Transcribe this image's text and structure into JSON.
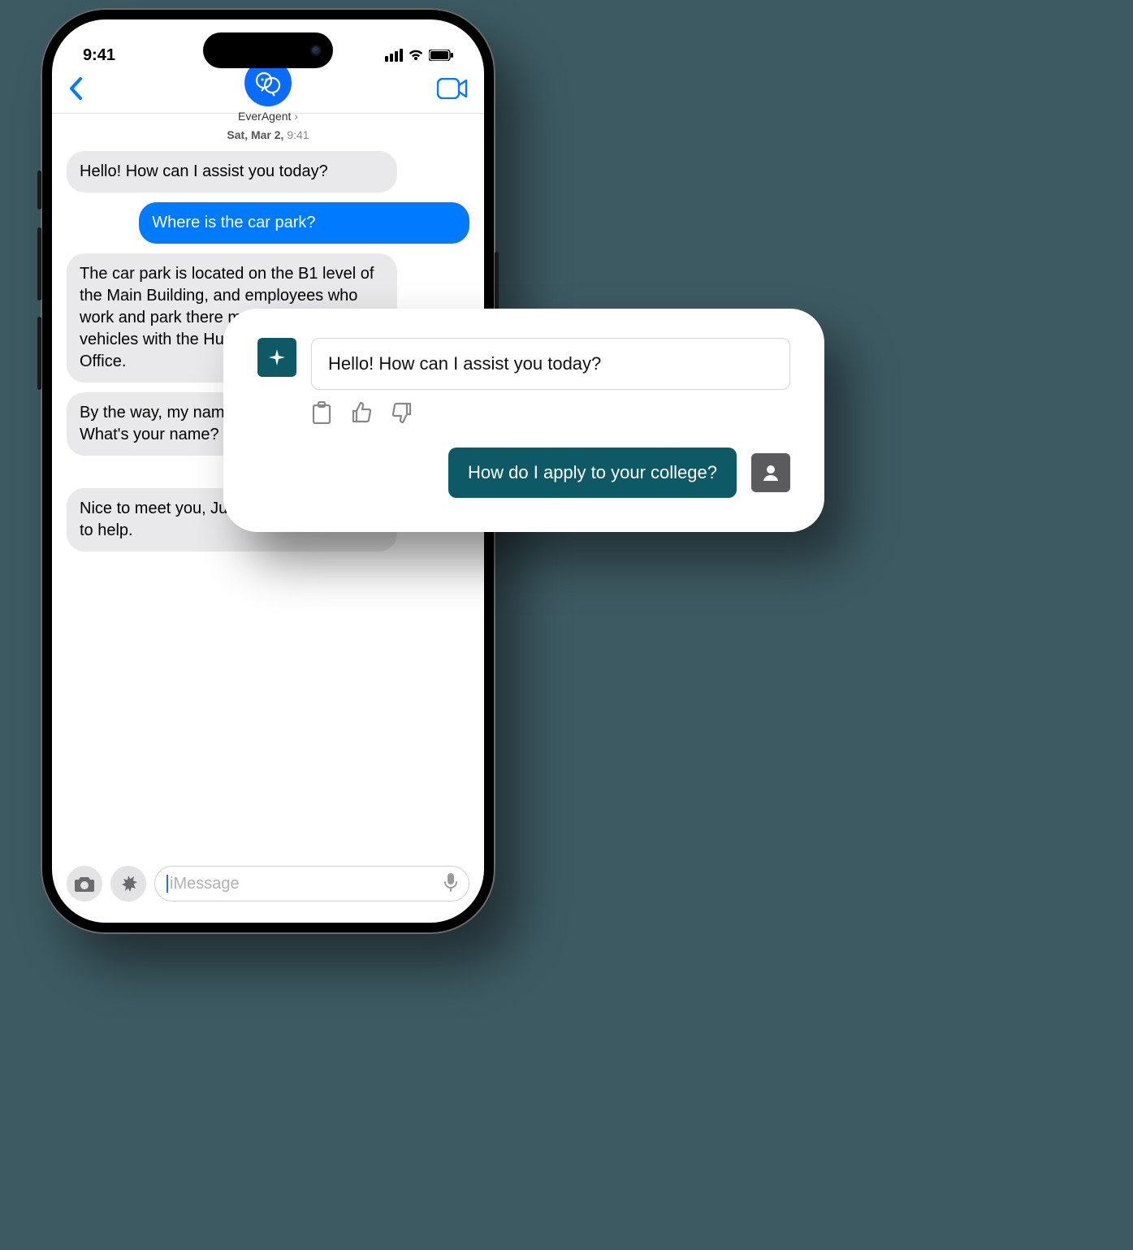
{
  "phone": {
    "status": {
      "time": "9:41"
    },
    "contact_name": "EverAgent",
    "timestamp_prefix": "Sat, Mar 2,",
    "timestamp_time": "9:41",
    "messages": {
      "m1": "Hello! How can I assist you today?",
      "m2": "Where is the car park?",
      "m3": "The car park is located on the B1 level of the Main Building, and employees who work and park there must register their vehicles with the Human Resources Office.",
      "m4": "By the way, my name is EverAgent. What's your name?",
      "m5": "Nice to meet you, Julien! I will try my best to help."
    },
    "input_placeholder": "iMessage"
  },
  "overlay": {
    "assistant_msg": "Hello! How can I assist you today?",
    "user_msg": "How do I apply to your college?"
  }
}
